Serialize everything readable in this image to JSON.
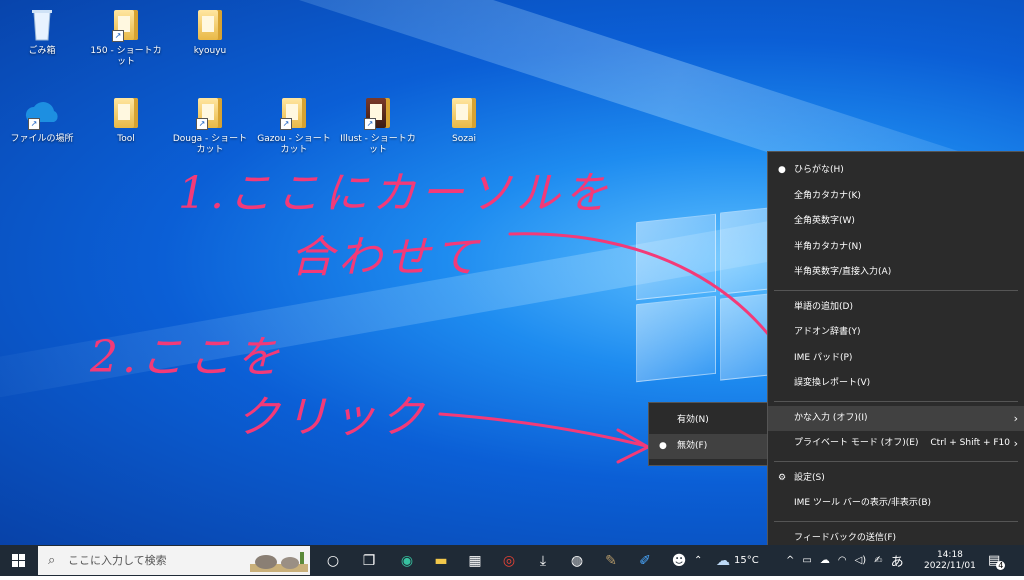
{
  "desktop": {
    "icons": [
      {
        "label": "ごみ箱"
      },
      {
        "label": "150 - ショートカット"
      },
      {
        "label": "kyouyu"
      },
      {
        "label": "ファイルの場所"
      },
      {
        "label": "Tool"
      },
      {
        "label": "Douga - ショートカット"
      },
      {
        "label": "Gazou - ショートカット"
      },
      {
        "label": "Illust - ショートカット"
      },
      {
        "label": "Sozai"
      }
    ]
  },
  "annotations": {
    "step1_line1": "1.ここにカーソルを",
    "step1_line2": "合わせて",
    "step2_line1": "2.ここを",
    "step2_line2": "クリック",
    "color": "#f33a78"
  },
  "ime_menu": {
    "items": [
      {
        "label": "ひらがな(H)",
        "selected": true
      },
      {
        "label": "全角カタカナ(K)"
      },
      {
        "label": "全角英数字(W)"
      },
      {
        "label": "半角カタカナ(N)"
      },
      {
        "label": "半角英数字/直接入力(A)"
      },
      {
        "label": "単語の追加(D)"
      },
      {
        "label": "アドオン辞書(Y)"
      },
      {
        "label": "IME パッド(P)"
      },
      {
        "label": "誤変換レポート(V)"
      },
      {
        "label": "かな入力 (オフ)(I)"
      },
      {
        "label": "プライベート モード (オフ)(E)",
        "shortcut": "Ctrl + Shift + F10"
      },
      {
        "label": "設定(S)"
      },
      {
        "label": "IME ツール バーの表示/非表示(B)"
      },
      {
        "label": "フィードバックの送信(F)"
      }
    ]
  },
  "kana_submenu": {
    "items": [
      {
        "label": "有効(N)"
      },
      {
        "label": "無効(F)",
        "selected": true
      }
    ]
  },
  "taskbar": {
    "search_placeholder": "ここに入力して検索",
    "weather": "15°C",
    "ime_mode": "あ",
    "time": "14:18",
    "date": "2022/11/01",
    "notification_count": "4",
    "bg": "#1f2a36"
  }
}
